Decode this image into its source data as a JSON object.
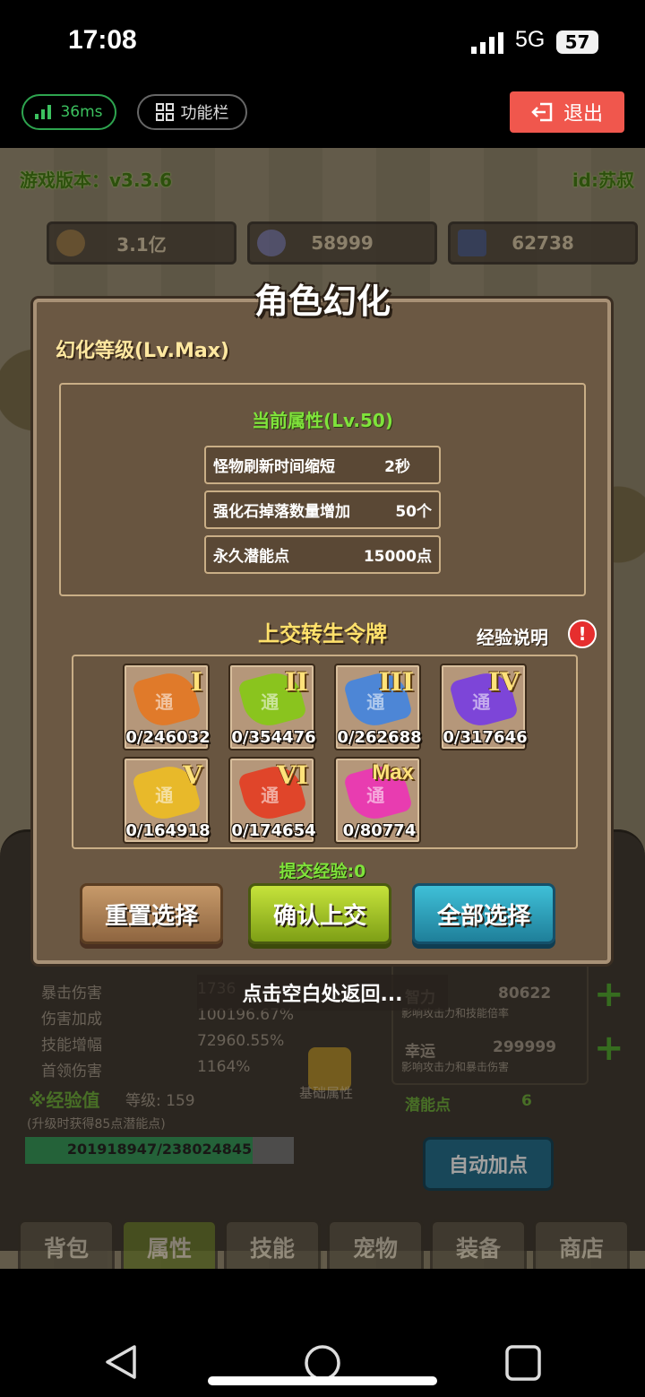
{
  "status_bar": {
    "time": "17:08",
    "network": "5G",
    "battery": "57"
  },
  "toolbar": {
    "ping": "36ms",
    "functions_label": "功能栏",
    "exit_label": "退出"
  },
  "game_header": {
    "version": "游戏版本：v3.3.6",
    "player_id": "id:苏叔"
  },
  "resources": [
    {
      "value": "3.1亿"
    },
    {
      "value": "58999"
    },
    {
      "value": "62738"
    }
  ],
  "background_stats": {
    "left": [
      {
        "label": "暴击伤害",
        "value": "1736"
      },
      {
        "label": "伤害加成",
        "value": "100196.67%"
      },
      {
        "label": "技能增幅",
        "value": "72960.55%"
      },
      {
        "label": "首领伤害",
        "value": "1164%"
      }
    ],
    "right": [
      {
        "label": "智力",
        "value": "80622",
        "desc": "影响攻击力和技能倍率"
      },
      {
        "label": "幸运",
        "value": "299999",
        "desc": "影响攻击力和暴击伤害"
      },
      {
        "label": "潜能点",
        "value": "6"
      }
    ],
    "base_attr": "基础属性",
    "exp_title": "※经验值",
    "exp_level": "等级: 159",
    "exp_note": "(升级时获得85点潜能点)",
    "exp_value": "201918947/238024845",
    "exp_progress": 0.848,
    "auto_add": "自动加点"
  },
  "bottom_nav": [
    {
      "label": "背包"
    },
    {
      "label": "属性"
    },
    {
      "label": "技能"
    },
    {
      "label": "宠物"
    },
    {
      "label": "装备"
    },
    {
      "label": "商店"
    }
  ],
  "dialog": {
    "title": "角色幻化",
    "level": "幻化等级(Lv.Max)",
    "current_attr_title": "当前属性(Lv.50)",
    "attributes": [
      {
        "name": "怪物刷新时间缩短",
        "value": "2秒"
      },
      {
        "name": "强化石掉落数量增加",
        "value": "50个"
      },
      {
        "name": "永久潜能点",
        "value": "15000点"
      }
    ],
    "tokens_title": "上交转生令牌",
    "exp_explain": "经验说明",
    "warn_glyph": "!",
    "token_glyph": "通",
    "tokens": [
      {
        "numeral": "I",
        "count": "0/246032",
        "color": "#e07a2a"
      },
      {
        "numeral": "II",
        "count": "0/354476",
        "color": "#8ac41e"
      },
      {
        "numeral": "III",
        "count": "0/262688",
        "color": "#4d86d6"
      },
      {
        "numeral": "IV",
        "count": "0/317646",
        "color": "#7d45d8"
      },
      {
        "numeral": "V",
        "count": "0/164918",
        "color": "#e8b92a"
      },
      {
        "numeral": "VI",
        "count": "0/174654",
        "color": "#e0452a"
      },
      {
        "numeral": "Max",
        "count": "0/80774",
        "color": "#e83cb0"
      }
    ],
    "submit_exp": "提交经验:0",
    "buttons": {
      "reset": "重置选择",
      "confirm": "确认上交",
      "select_all": "全部选择"
    },
    "tap_hint": "点击空白处返回..."
  }
}
